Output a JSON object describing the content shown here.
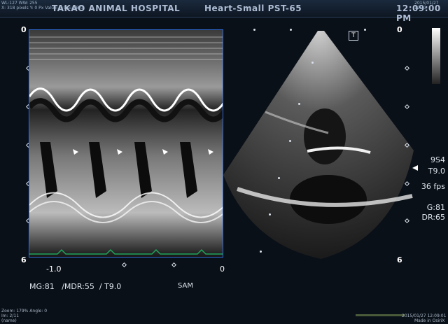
{
  "header": {
    "wl_ww": "WL:127 WW: 255",
    "info_line2": "X: 318 pixels Y: 0 Px Value: R:0 G:0 B:0",
    "hospital": "TAKAO ANIMAL HOSPITAL",
    "exam": "Heart-Small PST-65",
    "time": "12:09:00 PM",
    "datetime_small": "2015/01/27 12:13"
  },
  "mmode": {
    "depth_top": "0",
    "depth_bottom": "6",
    "time_labels": [
      "-1.0",
      "0"
    ],
    "bottom_params": "MG:81   /MDR:55  / T9.0",
    "sam_label": "SAM"
  },
  "sector": {
    "depth_top": "0",
    "depth_bottom": "6",
    "probe_marker": "T"
  },
  "right_params": {
    "probe": "9S4",
    "t": "T9.0",
    "fps": "36 fps",
    "gain": "G:81",
    "dr": "DR:65"
  },
  "footer": {
    "zoom": "Zoom: 179% Angle: 0",
    "im": "Im: 2/11",
    "name": "(name)",
    "date_right": "2015/01/27 12:09:01",
    "made_in": "Made in OsiriX"
  },
  "colors": {
    "frame_blue": "#2f6bd6",
    "ecg_green": "#1fa35a"
  }
}
